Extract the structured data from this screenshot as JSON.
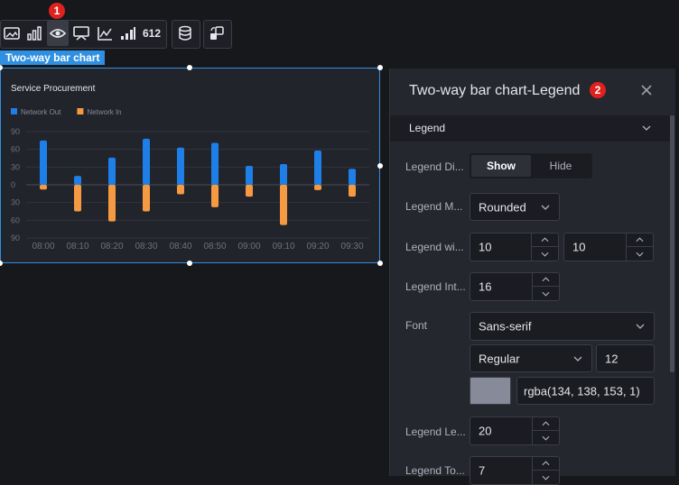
{
  "toolbar": {
    "icons": [
      "image-icon",
      "bar-chart-icon",
      "eye-icon",
      "monitor-icon",
      "line-chart-icon",
      "signal-bars-icon",
      "number-612-icon",
      "database-icon",
      "refresh-shapes-icon"
    ],
    "number_label": "612",
    "badge": "1"
  },
  "widget": {
    "tag": "Two-way bar chart"
  },
  "chart_data": {
    "type": "bar",
    "title": "Service Procurement",
    "categories": [
      "08:00",
      "08:10",
      "08:20",
      "08:30",
      "08:40",
      "08:50",
      "09:00",
      "09:10",
      "09:20",
      "09:30"
    ],
    "series": [
      {
        "name": "Network Out",
        "color": "#1e7fe8",
        "values": [
          75,
          15,
          46,
          78,
          63,
          71,
          32,
          35,
          58,
          27
        ]
      },
      {
        "name": "Network In",
        "color": "#f59a42",
        "values": [
          -8,
          -45,
          -62,
          -45,
          -16,
          -38,
          -20,
          -68,
          -9,
          -20
        ]
      }
    ],
    "ylim": [
      -90,
      90
    ],
    "ytick_labels": [
      "90",
      "60",
      "30",
      "0",
      "30",
      "60",
      "90"
    ],
    "grid": true,
    "legend_position": "top-left"
  },
  "panel": {
    "title": "Two-way bar chart-Legend",
    "badge": "2",
    "section": "Legend",
    "rows": {
      "display_label": "Legend Di...",
      "mode_label": "Legend M...",
      "width_label": "Legend wi...",
      "interval_label": "Legend Int...",
      "font_label": "Font",
      "left_label": "Legend Le...",
      "top_label": "Legend To..."
    },
    "display_options": {
      "show": "Show",
      "hide": "Hide"
    },
    "mode_value": "Rounded",
    "width_value": "10",
    "height_value": "10",
    "interval_value": "16",
    "font_family": "Sans-serif",
    "font_weight": "Regular",
    "font_size": "12",
    "font_color": "rgba(134, 138, 153, 1)",
    "left_value": "20",
    "top_value": "7"
  }
}
